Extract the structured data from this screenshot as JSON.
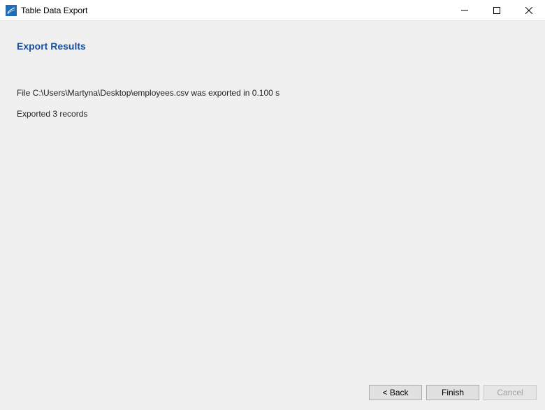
{
  "titlebar": {
    "title": "Table Data Export",
    "icon": "app-icon"
  },
  "heading": "Export Results",
  "status": {
    "line1": "File C:\\Users\\Martyna\\Desktop\\employees.csv was exported in 0.100 s",
    "line2": "Exported 3 records"
  },
  "buttons": {
    "back": "< Back",
    "finish": "Finish",
    "cancel": "Cancel"
  }
}
